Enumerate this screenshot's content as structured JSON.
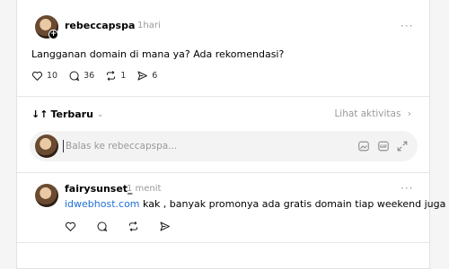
{
  "post": {
    "author": "rebeccapspa",
    "time": "1hari",
    "text": "Langganan domain di mana ya? Ada rekomendasi?",
    "likes": "10",
    "comments": "36",
    "reposts": "1",
    "shares": "6",
    "more": "···"
  },
  "thread": {
    "sort_label": "Terbaru",
    "sort_icon": "↓↑",
    "activity_label": "Lihat aktivitas",
    "activity_chevron": "›",
    "sort_chevron": "⌄"
  },
  "reply_box": {
    "placeholder": "Balas ke rebeccapspa..."
  },
  "comment": {
    "author": "fairysunset_",
    "time": "1 menit",
    "link": "idwebhost.com",
    "text": " kak , banyak promonya ada gratis domain tiap weekend juga",
    "more": "···"
  }
}
